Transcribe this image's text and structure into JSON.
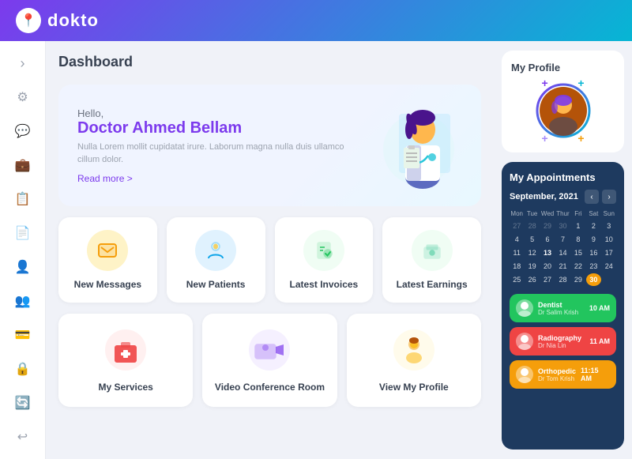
{
  "header": {
    "logo_text": "dokto",
    "logo_icon": "📍"
  },
  "sidebar": {
    "toggle_icon": "›",
    "items": [
      {
        "id": "settings",
        "icon": "⚙",
        "label": "Settings"
      },
      {
        "id": "messages",
        "icon": "💬",
        "label": "Messages"
      },
      {
        "id": "briefcase",
        "icon": "💼",
        "label": "Work"
      },
      {
        "id": "calendar",
        "icon": "📋",
        "label": "Calendar"
      },
      {
        "id": "documents",
        "icon": "📄",
        "label": "Documents"
      },
      {
        "id": "user",
        "icon": "👤",
        "label": "Profile"
      },
      {
        "id": "group",
        "icon": "👥",
        "label": "Users"
      },
      {
        "id": "card",
        "icon": "💳",
        "label": "Payment"
      },
      {
        "id": "lock",
        "icon": "🔒",
        "label": "Security"
      },
      {
        "id": "refresh",
        "icon": "🔄",
        "label": "Sync"
      },
      {
        "id": "logout",
        "icon": "↩",
        "label": "Logout"
      }
    ]
  },
  "dashboard": {
    "title": "Dashboard",
    "welcome": {
      "greeting": "Hello,",
      "name": "Doctor Ahmed Bellam",
      "description": "Nulla Lorem mollit cupidatat irure. Laborum magna nulla duis ullamco cillum dolor.",
      "read_more": "Read more >"
    },
    "stat_cards": [
      {
        "id": "messages",
        "label": "New Messages",
        "bg": "#fef3c7",
        "icon": "💬",
        "icon_color": "#f59e0b"
      },
      {
        "id": "patients",
        "label": "New Patients",
        "bg": "#e0f2fe",
        "icon": "🧍",
        "icon_color": "#0ea5e9"
      },
      {
        "id": "invoices",
        "label": "Latest Invoices",
        "bg": "#f0fdf4",
        "icon": "📄",
        "icon_color": "#22c55e"
      },
      {
        "id": "earnings",
        "label": "Latest Earnings",
        "bg": "#f0fdf4",
        "icon": "💵",
        "icon_color": "#10b981"
      }
    ],
    "action_cards": [
      {
        "id": "services",
        "label": "My Services",
        "icon": "🧰",
        "icon_color": "#ef4444"
      },
      {
        "id": "video",
        "label": "Video Conference Room",
        "icon": "🎥",
        "icon_color": "#7c3aed"
      },
      {
        "id": "profile",
        "label": "View My Profile",
        "icon": "🧑",
        "icon_color": "#f59e0b"
      }
    ]
  },
  "profile_card": {
    "title": "My Profile"
  },
  "appointments": {
    "title": "My Appointments",
    "month": "September, 2021",
    "day_headers": [
      "Mon",
      "Tue",
      "Wed",
      "Thur",
      "Fri",
      "Sat",
      "Sun"
    ],
    "weeks": [
      [
        "27",
        "28",
        "29",
        "30",
        "1",
        "2",
        "3"
      ],
      [
        "4",
        "5",
        "6",
        "7",
        "8",
        "9",
        "10"
      ],
      [
        "11",
        "12",
        "13",
        "14",
        "15",
        "16",
        "17"
      ],
      [
        "18",
        "19",
        "20",
        "21",
        "22",
        "23",
        "24"
      ],
      [
        "25",
        "26",
        "27",
        "28",
        "29",
        "30",
        ""
      ]
    ],
    "today": "30",
    "today_week": 4,
    "today_col": 4,
    "items": [
      {
        "id": "dentist",
        "type": "dentist",
        "specialty": "Dentist",
        "doctor": "Dr Salim Krish",
        "time": "10 AM"
      },
      {
        "id": "radio",
        "type": "radio",
        "specialty": "Radiography",
        "doctor": "Dr Nia Lin",
        "time": "11 AM"
      },
      {
        "id": "ortho",
        "type": "ortho",
        "specialty": "Orthopedic",
        "doctor": "Dr Tom Krish",
        "time": "11:15 AM"
      }
    ]
  }
}
